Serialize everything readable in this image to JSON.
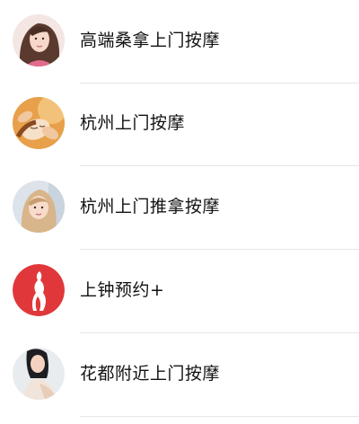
{
  "list": {
    "items": [
      {
        "title": "高端桑拿上门按摩",
        "avatar": "woman-portrait-avatar"
      },
      {
        "title": "杭州上门按摩",
        "avatar": "facial-massage-avatar"
      },
      {
        "title": "杭州上门推拿按摩",
        "avatar": "woman-selfie-avatar"
      },
      {
        "title": "上钟预约+",
        "avatar": "red-silhouette-logo"
      },
      {
        "title": "花都附近上门按摩",
        "avatar": "woman-sitting-avatar"
      }
    ]
  },
  "colors": {
    "text": "#111111",
    "divider": "#e6e6e6",
    "logo_red": "#e0383a"
  }
}
